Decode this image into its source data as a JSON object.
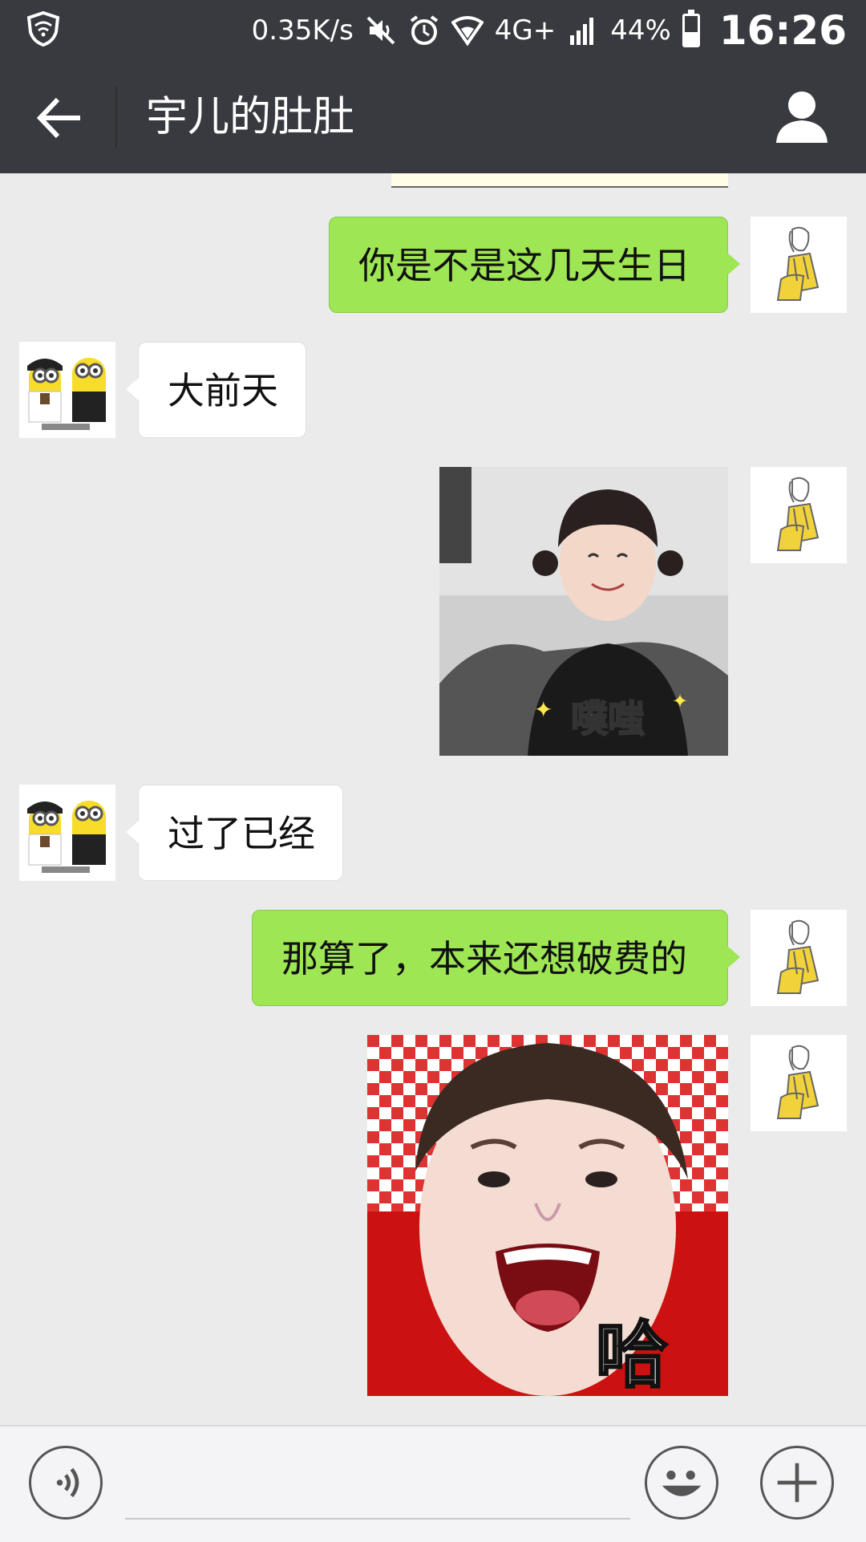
{
  "status_bar": {
    "net_speed": "0.35K/s",
    "network": "4G+",
    "battery": "44%",
    "battery_level": 0.44,
    "time": "16:26",
    "icons": [
      "shield-icon",
      "mute-icon",
      "alarm-icon",
      "wifi-icon",
      "signal-icon",
      "battery-icon"
    ]
  },
  "header": {
    "title": "宇儿的肚肚",
    "back_icon": "arrow-left-icon",
    "profile_icon": "person-icon",
    "bg_color": "#393a3f"
  },
  "messages": [
    {
      "sender": "me",
      "type": "text",
      "text": "你是不是这几天生日"
    },
    {
      "sender": "them",
      "type": "text",
      "text": "大前天"
    },
    {
      "sender": "me",
      "type": "image",
      "caption": "噗嗤"
    },
    {
      "sender": "them",
      "type": "text",
      "text": "过了已经"
    },
    {
      "sender": "me",
      "type": "text",
      "text": "那算了，本来还想破费的"
    },
    {
      "sender": "me",
      "type": "image",
      "caption": "哈"
    }
  ],
  "input_bar": {
    "voice_icon": "voice-icon",
    "emoji_icon": "emoji-icon",
    "plus_icon": "plus-icon",
    "value": "",
    "placeholder": ""
  },
  "colors": {
    "my_bubble": "#9ee654",
    "their_bubble": "#ffffff",
    "chat_bg": "#ebebeb"
  }
}
